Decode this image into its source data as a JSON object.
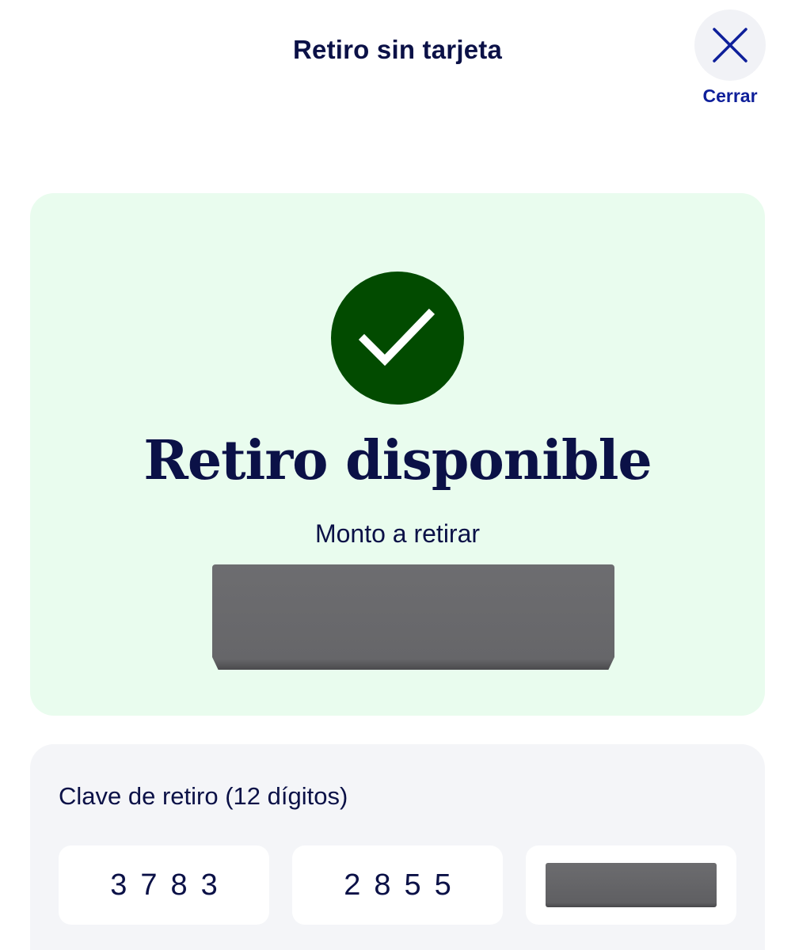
{
  "header": {
    "title": "Retiro sin tarjeta",
    "close_label": "Cerrar"
  },
  "status": {
    "title": "Retiro disponible",
    "amount_label": "Monto a retirar"
  },
  "code": {
    "label": "Clave de retiro (12 dígitos)",
    "groups": [
      "3783",
      "2855"
    ]
  },
  "colors": {
    "primary_text": "#0b1147",
    "accent": "#0e1f9a",
    "success": "#024b00",
    "success_bg": "#e9fcee"
  }
}
